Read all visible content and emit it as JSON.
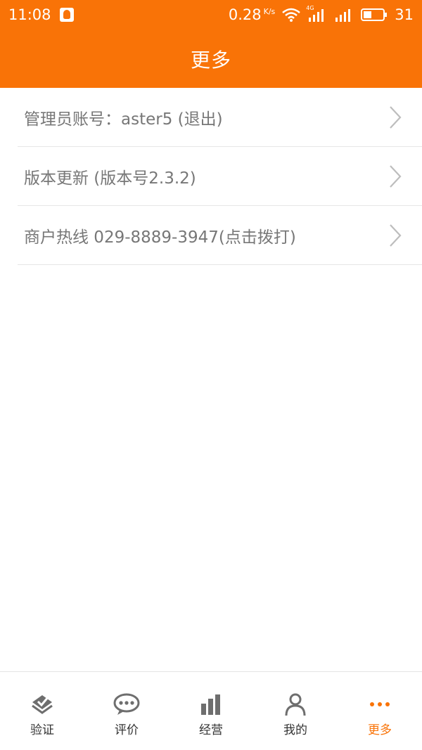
{
  "status_bar": {
    "time": "11:08",
    "net_speed": "0.28",
    "net_unit": "K/s",
    "network_type": "4G",
    "battery": "31",
    "icons": [
      "qq-icon",
      "wifi-icon",
      "signal-4g-icon",
      "signal-icon",
      "battery-icon"
    ]
  },
  "header": {
    "title": "更多"
  },
  "menu": {
    "items": [
      {
        "label": "管理员账号：aster5  (退出)",
        "icon": "chevron-right-icon"
      },
      {
        "label": "版本更新  (版本号2.3.2)",
        "icon": "chevron-right-icon"
      },
      {
        "label": "商户热线  029-8889-3947(点击拨打)",
        "icon": "chevron-right-icon"
      }
    ]
  },
  "tabbar": {
    "tabs": [
      {
        "label": "验证",
        "icon": "verify-icon",
        "active": false
      },
      {
        "label": "评价",
        "icon": "comment-icon",
        "active": false
      },
      {
        "label": "经营",
        "icon": "bar-chart-icon",
        "active": false
      },
      {
        "label": "我的",
        "icon": "person-icon",
        "active": false
      },
      {
        "label": "更多",
        "icon": "more-dots-icon",
        "active": true
      }
    ]
  },
  "colors": {
    "brand": "#f97307",
    "text_muted": "#777777",
    "divider": "#e6e6e6",
    "tab_icon": "#6e6e6e"
  }
}
